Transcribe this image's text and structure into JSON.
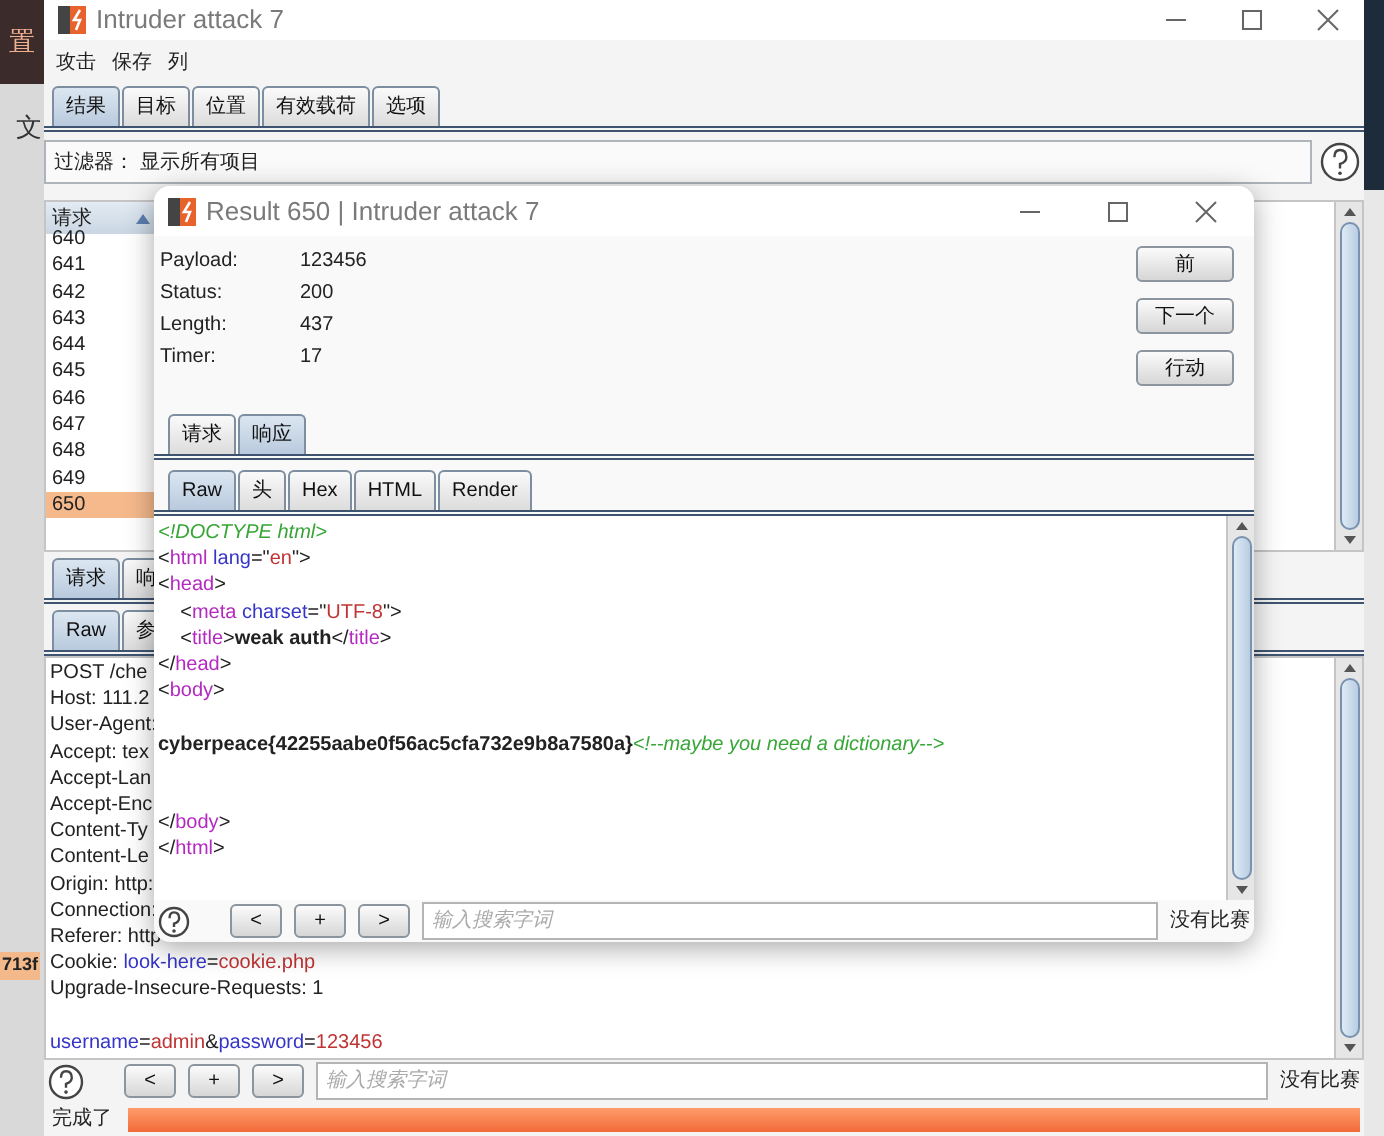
{
  "desktop": {
    "texts": [
      {
        "text": "置",
        "kind": "dark"
      },
      {
        "text": "文",
        "kind": "plain"
      },
      {
        "text": "713f",
        "kind": "tag"
      }
    ]
  },
  "main_window": {
    "title": "Intruder attack 7",
    "menu": [
      "攻击",
      "保存",
      "列"
    ],
    "tabs": [
      {
        "label": "结果",
        "selected": true
      },
      {
        "label": "目标",
        "selected": false
      },
      {
        "label": "位置",
        "selected": false
      },
      {
        "label": "有效载荷",
        "selected": false
      },
      {
        "label": "选项",
        "selected": false
      }
    ],
    "filter": {
      "label": "过滤器：",
      "value": "显示所有项目"
    },
    "table": {
      "columns": [
        "请求"
      ],
      "rows": [
        {
          "cells": [
            "640"
          ],
          "selected": false
        },
        {
          "cells": [
            "641"
          ],
          "selected": false
        },
        {
          "cells": [
            "642"
          ],
          "selected": false
        },
        {
          "cells": [
            "643"
          ],
          "selected": false
        },
        {
          "cells": [
            "644"
          ],
          "selected": false
        },
        {
          "cells": [
            "645"
          ],
          "selected": false
        },
        {
          "cells": [
            "646"
          ],
          "selected": false
        },
        {
          "cells": [
            "647"
          ],
          "selected": false
        },
        {
          "cells": [
            "648"
          ],
          "selected": false
        },
        {
          "cells": [
            "649"
          ],
          "selected": false
        },
        {
          "cells": [
            "650"
          ],
          "selected": true
        }
      ]
    },
    "lower_tabs": [
      {
        "label": "请求",
        "selected": true
      },
      {
        "label": "响",
        "selected": false
      }
    ],
    "view_tabs": [
      {
        "label": "Raw",
        "selected": true
      },
      {
        "label": "参",
        "selected": false
      }
    ],
    "request_lines": [
      {
        "kind": "code",
        "parts": [
          {
            "kind": "plain",
            "text": "POST /che"
          }
        ]
      },
      {
        "kind": "code",
        "parts": [
          {
            "kind": "plain",
            "text": "Host: 111.2"
          }
        ]
      },
      {
        "kind": "code",
        "parts": [
          {
            "kind": "plain",
            "text": "User-Agent:"
          }
        ]
      },
      {
        "kind": "code",
        "parts": [
          {
            "kind": "plain",
            "text": "Accept: tex"
          }
        ]
      },
      {
        "kind": "code",
        "parts": [
          {
            "kind": "plain",
            "text": "Accept-Lan"
          }
        ]
      },
      {
        "kind": "code",
        "parts": [
          {
            "kind": "plain",
            "text": "Accept-Enc"
          }
        ]
      },
      {
        "kind": "code",
        "parts": [
          {
            "kind": "plain",
            "text": "Content-Ty"
          }
        ]
      },
      {
        "kind": "code",
        "parts": [
          {
            "kind": "plain",
            "text": "Content-Le"
          }
        ]
      },
      {
        "kind": "code",
        "parts": [
          {
            "kind": "plain",
            "text": "Origin: http:"
          }
        ]
      },
      {
        "kind": "code",
        "parts": [
          {
            "kind": "plain",
            "text": "Connection:"
          }
        ]
      },
      {
        "kind": "code",
        "parts": [
          {
            "kind": "plain",
            "text": "Referer: http"
          }
        ]
      },
      {
        "kind": "code",
        "parts": [
          {
            "kind": "plain",
            "text": "Cookie: "
          },
          {
            "kind": "attr",
            "text": "look-here"
          },
          {
            "kind": "plain",
            "text": "="
          },
          {
            "kind": "value",
            "text": "cookie.php"
          }
        ]
      },
      {
        "kind": "code",
        "parts": [
          {
            "kind": "plain",
            "text": "Upgrade-Insecure-Requests: 1"
          }
        ]
      },
      {
        "kind": "blank"
      },
      {
        "kind": "code",
        "parts": [
          {
            "kind": "attr",
            "text": "username"
          },
          {
            "kind": "plain",
            "text": "="
          },
          {
            "kind": "value",
            "text": "admin"
          },
          {
            "kind": "plain",
            "text": "&"
          },
          {
            "kind": "attr",
            "text": "password"
          },
          {
            "kind": "plain",
            "text": "="
          },
          {
            "kind": "value",
            "text": "123456"
          }
        ]
      }
    ],
    "search": {
      "buttons": [
        "<",
        "+",
        ">"
      ],
      "placeholder": "输入搜索字词",
      "result": "没有比赛"
    },
    "status": {
      "text": "完成了",
      "level": 1
    }
  },
  "result_window": {
    "title": "Result 650 | Intruder attack 7",
    "fields": [
      {
        "label": "Payload:",
        "value": "123456"
      },
      {
        "label": "Status:",
        "value": "200"
      },
      {
        "label": "Length:",
        "value": "437"
      },
      {
        "label": "Timer:",
        "value": "17"
      }
    ],
    "buttons": [
      "前",
      "下一个",
      "行动"
    ],
    "tabs": [
      {
        "label": "请求",
        "selected": false
      },
      {
        "label": "响应",
        "selected": true
      }
    ],
    "view_tabs": [
      {
        "label": "Raw",
        "selected": true
      },
      {
        "label": "头",
        "selected": false
      },
      {
        "label": "Hex",
        "selected": false
      },
      {
        "label": "HTML",
        "selected": false
      },
      {
        "label": "Render",
        "selected": false
      }
    ],
    "code_lines": [
      {
        "kind": "code",
        "parts": [
          {
            "kind": "comment",
            "text": "<!DOCTYPE html>"
          }
        ]
      },
      {
        "kind": "code",
        "parts": [
          {
            "kind": "plain",
            "text": "<"
          },
          {
            "kind": "tag",
            "text": "html"
          },
          {
            "kind": "space"
          },
          {
            "kind": "attr",
            "text": "lang"
          },
          {
            "kind": "plain",
            "text": "=\""
          },
          {
            "kind": "value",
            "text": "en"
          },
          {
            "kind": "plain",
            "text": "\">"
          }
        ]
      },
      {
        "kind": "code",
        "parts": [
          {
            "kind": "plain",
            "text": "<"
          },
          {
            "kind": "tag",
            "text": "head"
          },
          {
            "kind": "plain",
            "text": ">"
          }
        ]
      },
      {
        "kind": "code",
        "parts": [
          {
            "kind": "plain",
            "text": "    <"
          },
          {
            "kind": "tag",
            "text": "meta"
          },
          {
            "kind": "space"
          },
          {
            "kind": "attr",
            "text": "charset"
          },
          {
            "kind": "plain",
            "text": "=\""
          },
          {
            "kind": "value",
            "text": "UTF-8"
          },
          {
            "kind": "plain",
            "text": "\">"
          }
        ]
      },
      {
        "kind": "code",
        "parts": [
          {
            "kind": "plain",
            "text": "    <"
          },
          {
            "kind": "tag",
            "text": "title"
          },
          {
            "kind": "plain",
            "text": ">"
          },
          {
            "kind": "bold",
            "text": "weak auth"
          },
          {
            "kind": "plain",
            "text": "</"
          },
          {
            "kind": "tag",
            "text": "title"
          },
          {
            "kind": "plain",
            "text": ">"
          }
        ]
      },
      {
        "kind": "code",
        "parts": [
          {
            "kind": "plain",
            "text": "</"
          },
          {
            "kind": "tag",
            "text": "head"
          },
          {
            "kind": "plain",
            "text": ">"
          }
        ]
      },
      {
        "kind": "code",
        "parts": [
          {
            "kind": "plain",
            "text": "<"
          },
          {
            "kind": "tag",
            "text": "body"
          },
          {
            "kind": "plain",
            "text": ">"
          }
        ]
      },
      {
        "kind": "blank"
      },
      {
        "kind": "code",
        "parts": [
          {
            "kind": "bold",
            "text": "cyberpeace{42255aabe0f56ac5cfa732e9b8a7580a}"
          },
          {
            "kind": "comment",
            "text": "<!--maybe you need a dictionary-->"
          }
        ]
      },
      {
        "kind": "blank"
      },
      {
        "kind": "blank"
      },
      {
        "kind": "code",
        "parts": [
          {
            "kind": "plain",
            "text": "</"
          },
          {
            "kind": "tag",
            "text": "body"
          },
          {
            "kind": "plain",
            "text": ">"
          }
        ]
      },
      {
        "kind": "code",
        "parts": [
          {
            "kind": "plain",
            "text": "</"
          },
          {
            "kind": "tag",
            "text": "html"
          },
          {
            "kind": "plain",
            "text": ">"
          }
        ]
      }
    ],
    "search": {
      "buttons": [
        "<",
        "+",
        ">"
      ],
      "placeholder": "输入搜索字词",
      "result": "没有比赛"
    }
  }
}
